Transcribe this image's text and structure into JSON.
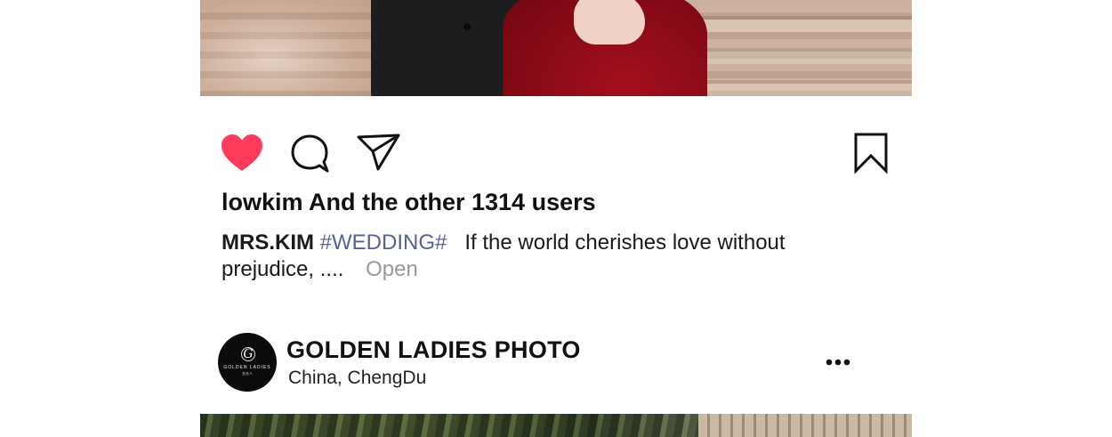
{
  "post": {
    "likes_text": "lowkim And the other 1314 users",
    "caption": {
      "username": "MRS.KIM",
      "hashtag": "#WEDDING#",
      "text": "If the world cherishes love without prejudice, ....",
      "open_label": "Open"
    },
    "liked": true,
    "like_color": "#ff3b5c"
  },
  "next_post": {
    "account_name": "GOLDEN LADIES PHOTO",
    "location": "China,  ChengDu",
    "avatar": {
      "monogram": "G",
      "brand": "GOLDEN LADIES",
      "sub": "金夫人"
    }
  },
  "icons": {
    "like": "heart-icon",
    "comment": "comment-bubble-icon",
    "share": "paper-plane-icon",
    "save": "bookmark-icon",
    "more": "ellipsis-icon"
  },
  "colors": {
    "hashtag": "#5a5f96",
    "open_link": "#9a9a9a",
    "text": "#111111"
  }
}
